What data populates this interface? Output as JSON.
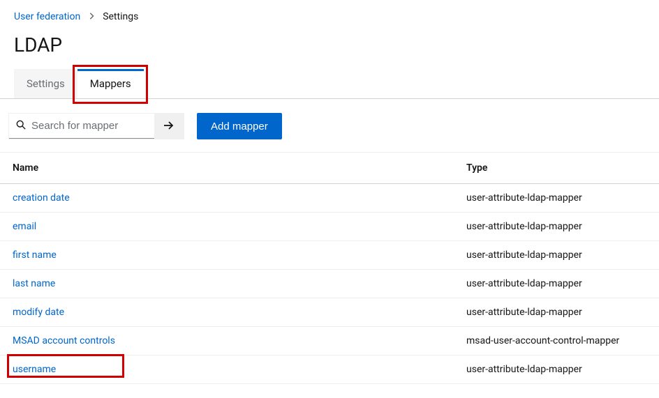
{
  "breadcrumb": {
    "parent": "User federation",
    "current": "Settings"
  },
  "title": "LDAP",
  "tabs": {
    "settings": "Settings",
    "mappers": "Mappers"
  },
  "toolbar": {
    "search_placeholder": "Search for mapper",
    "add_button": "Add mapper"
  },
  "table": {
    "headers": {
      "name": "Name",
      "type": "Type"
    },
    "rows": [
      {
        "name": "creation date",
        "type": "user-attribute-ldap-mapper"
      },
      {
        "name": "email",
        "type": "user-attribute-ldap-mapper"
      },
      {
        "name": "first name",
        "type": "user-attribute-ldap-mapper"
      },
      {
        "name": "last name",
        "type": "user-attribute-ldap-mapper"
      },
      {
        "name": "modify date",
        "type": "user-attribute-ldap-mapper"
      },
      {
        "name": "MSAD account controls",
        "type": "msad-user-account-control-mapper"
      },
      {
        "name": "username",
        "type": "user-attribute-ldap-mapper"
      }
    ]
  }
}
